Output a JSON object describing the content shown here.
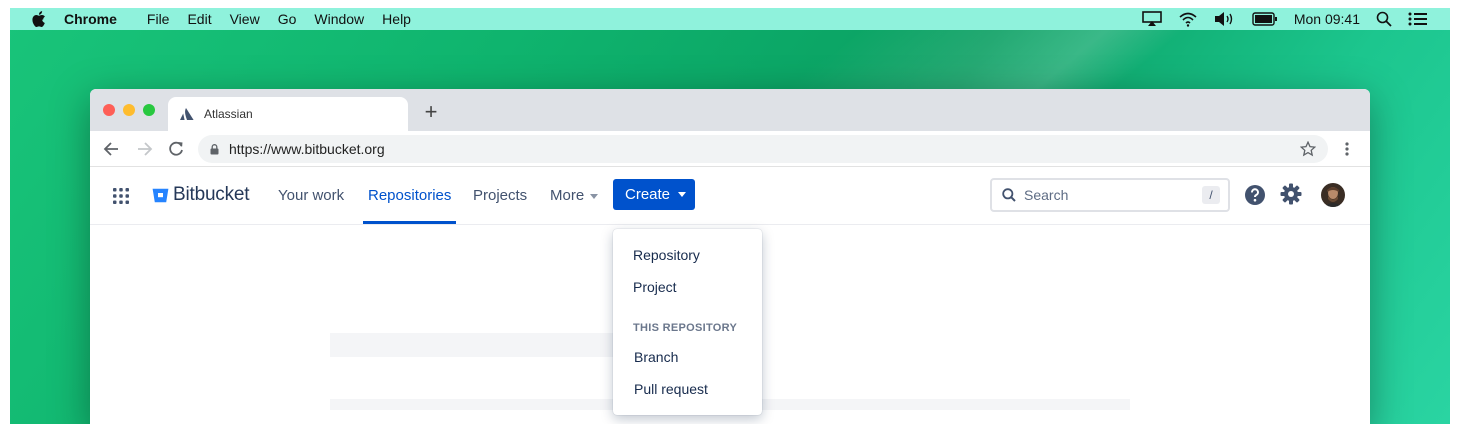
{
  "menubar": {
    "app_name": "Chrome",
    "items": [
      "File",
      "Edit",
      "View",
      "Go",
      "Window",
      "Help"
    ],
    "clock": "Mon 09:41"
  },
  "browser": {
    "tab_title": "Atlassian",
    "new_tab": "+",
    "url": "https://www.bitbucket.org"
  },
  "bitbucket": {
    "logo_text": "Bitbucket",
    "nav": {
      "your_work": "Your work",
      "repositories": "Repositories",
      "projects": "Projects",
      "more": "More"
    },
    "create_label": "Create",
    "search": {
      "placeholder": "Search",
      "shortcut": "/"
    }
  },
  "create_menu": {
    "items": [
      "Repository",
      "Project"
    ],
    "section_heading": "THIS REPOSITORY",
    "section_items": [
      "Branch",
      "Pull request"
    ]
  },
  "colors": {
    "accent": "#0052cc",
    "desktop": "#0fb46e",
    "menubar": "#8ff2dc"
  }
}
